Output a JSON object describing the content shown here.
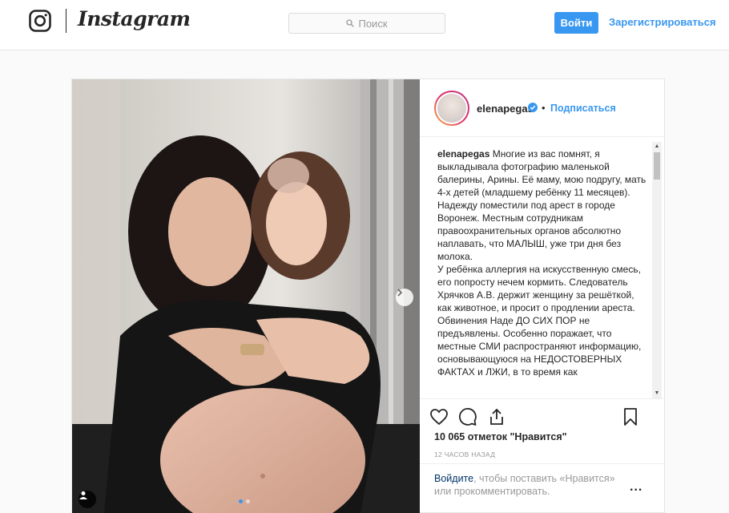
{
  "header": {
    "wordmark": "Instagram",
    "search_placeholder": "Поиск",
    "login_label": "Войти",
    "signup_label": "Зарегистрироваться"
  },
  "post": {
    "username": "elenapegas",
    "bullet": "•",
    "follow_label": "Подписаться",
    "caption_user": "elenapegas",
    "caption_text": " Многие из вас помнят, я выкладывала фотографию маленькой балерины, Арины. Её маму, мою подругу, мать 4-х детей (младшему ребёнку 11 месяцев). Надежду поместили под арест в городе Воронеж. Местным сотрудникам правоохранительных органов абсолютно наплавать, что МАЛЫШ, уже три дня без молока.\nУ ребёнка аллергия на искусственную смесь, его попросту нечем кормить. Следователь Хрячков А.В. держит женщину за решёткой, как животное, и просит о продлении ареста. Обвинения Наде ДО СИХ ПОР не предъявлены. Особенно поражает, что местные СМИ распространяют информацию, основывающуюся на НЕДОСТОВЕРНЫХ ФАКТАХ и ЛЖИ, в то время как",
    "likes": "10 065 отметок \"Нравится\"",
    "time_ago": "12 ЧАСОВ НАЗАД",
    "prompt_link": "Войдите",
    "prompt_rest": ", чтобы поставить «Нравится» или прокомментировать.",
    "more": "...",
    "carousel_index": 1,
    "carousel_count": 2
  },
  "colors": {
    "accent": "#3897f0",
    "header_bg": "#ffffff",
    "page_bg": "#fafafa"
  },
  "icons": [
    "instagram-camera-icon",
    "search-icon",
    "verified-icon",
    "chevron-right-icon",
    "heart-icon",
    "comment-icon",
    "share-icon",
    "bookmark-icon",
    "user-tag-icon"
  ]
}
